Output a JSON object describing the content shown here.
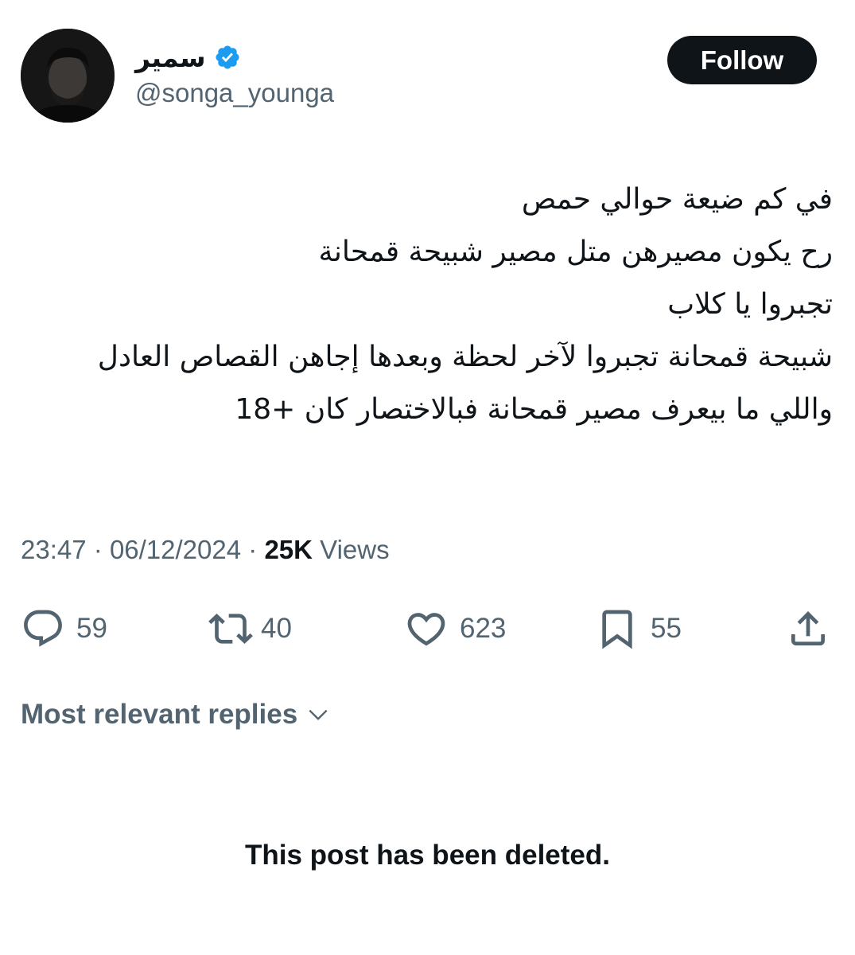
{
  "author": {
    "display_name": "سمير",
    "handle": "@songa_younga",
    "verified": true,
    "avatar_icon": "profile-photo"
  },
  "follow_button": {
    "label": "Follow"
  },
  "tweet": {
    "lines": [
      "في كم ضيعة حوالي حمص",
      "رح يكون مصيرهن متل مصير شبيحة قمحانة",
      "تجبروا يا كلاب",
      "شبيحة قمحانة تجبروا لآخر لحظة وبعدها إجاهن القصاص العادل",
      "واللي ما بيعرف مصير قمحانة فبالاختصار كان +18"
    ]
  },
  "meta": {
    "time": "23:47",
    "separator": "·",
    "date": "06/12/2024",
    "views_count": "25K",
    "views_label": "Views"
  },
  "actions": {
    "replies": {
      "icon": "reply-icon",
      "count": "59"
    },
    "retweets": {
      "icon": "retweet-icon",
      "count": "40"
    },
    "likes": {
      "icon": "heart-icon",
      "count": "623"
    },
    "bookmarks": {
      "icon": "bookmark-icon",
      "count": "55"
    },
    "share": {
      "icon": "share-icon"
    }
  },
  "replies_filter": {
    "label": "Most relevant replies"
  },
  "deleted_notice": "This post has been deleted.",
  "colors": {
    "text": "#0f1419",
    "secondary": "#536471",
    "verified_blue": "#1d9bf0",
    "button_bg": "#0f1419"
  }
}
